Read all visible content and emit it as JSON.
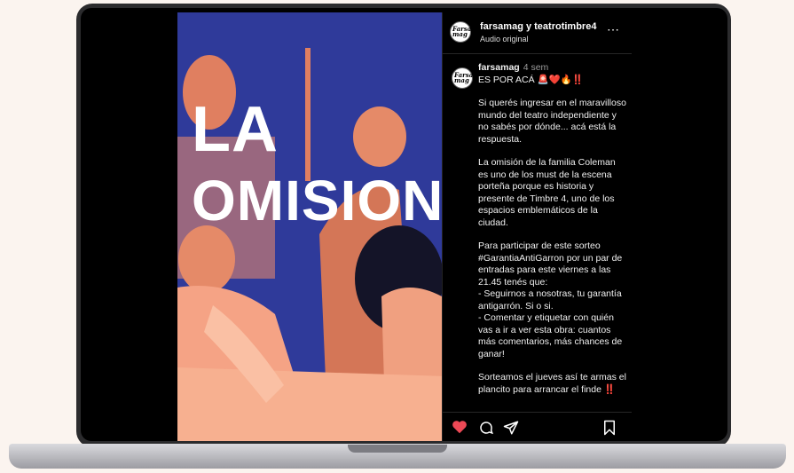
{
  "poster": {
    "title_line1": "LA",
    "title_line2": "OMISION",
    "colors": {
      "bg": "#2f3a9a",
      "accent": "#f08c6a"
    }
  },
  "post": {
    "header": {
      "user": "farsamag y teatrotimbre4",
      "audio": "Audio original",
      "more_icon": "⋯"
    },
    "avatar_text": "Farsa mag",
    "caption": {
      "author": "farsamag",
      "time": "4 sem",
      "headline": "ES POR ACÁ 🚨❤️🔥‼️",
      "paragraphs": [
        "Si querés ingresar en el maravilloso mundo del teatro independiente y no sabés por dónde... acá está la respuesta.",
        "La omisión de la familia Coleman es uno de los must de la escena porteña porque es historia y presente de Timbre 4, uno de los espacios emblemáticos de la ciudad.",
        "Para participar de este sorteo #GarantiaAntiGarron por un par de entradas para este viernes a las 21.45 tenés que:\n- Seguirnos a nosotras, tu garantía antigarrón. Si o si.\n- Comentar y etiquetar con quién vas a ir a ver esta obra: cuantos más comentarios, más chances de ganar!",
        "Sorteamos el jueves así te armas el plancito para arrancar el finde ‼️"
      ]
    },
    "actions": {
      "like_icon": "heart-icon",
      "comment_icon": "comment-icon",
      "share_icon": "share-icon",
      "save_icon": "bookmark-icon"
    }
  }
}
